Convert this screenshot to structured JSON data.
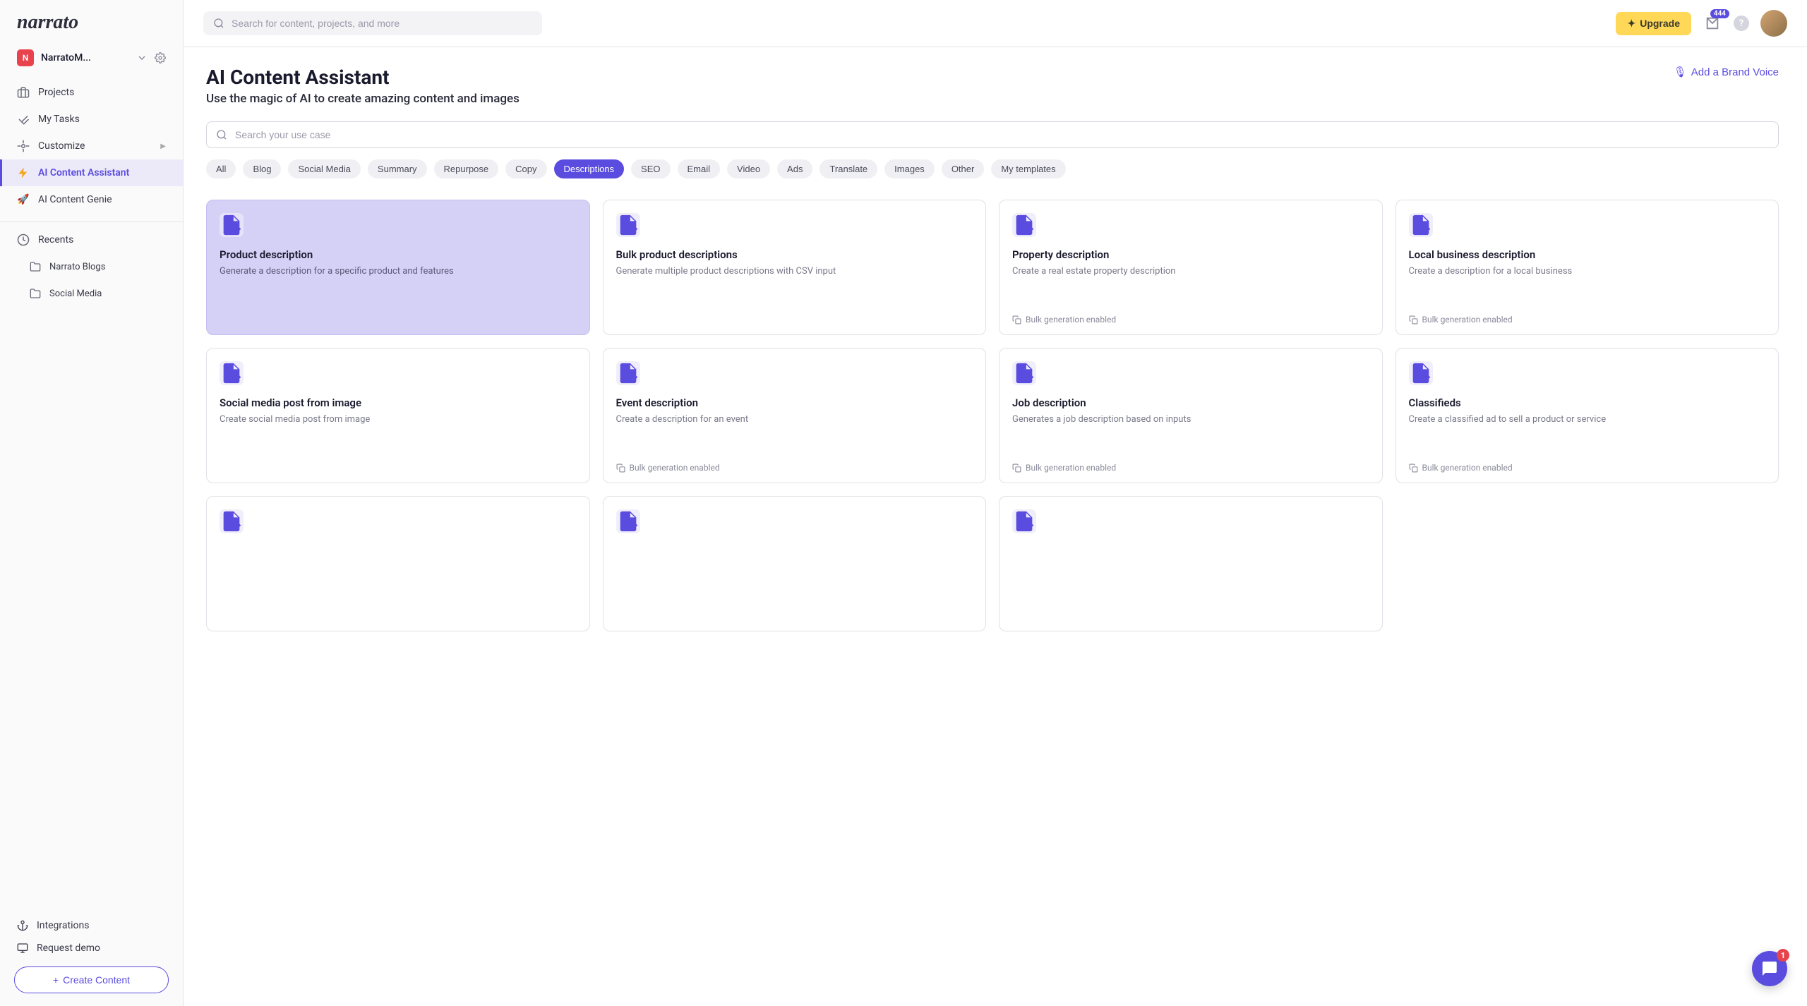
{
  "logo": "narrato",
  "workspace": {
    "badge": "N",
    "name": "NarratoM..."
  },
  "nav": {
    "projects": "Projects",
    "tasks": "My Tasks",
    "customize": "Customize",
    "assistant": "AI Content Assistant",
    "genie": "AI Content Genie",
    "recents": "Recents",
    "recent1": "Narrato Blogs",
    "recent2": "Social Media"
  },
  "footer": {
    "integrations": "Integrations",
    "demo": "Request demo",
    "create": "Create Content"
  },
  "topbar": {
    "search_placeholder": "Search for content, projects, and more",
    "upgrade": "Upgrade",
    "notif_count": "444",
    "chat_badge": "1"
  },
  "page": {
    "title": "AI Content Assistant",
    "subtitle": "Use the magic of AI to create amazing content and images",
    "brand_voice": "Add a Brand Voice",
    "usecase_placeholder": "Search your use case"
  },
  "chips": [
    "All",
    "Blog",
    "Social Media",
    "Summary",
    "Repurpose",
    "Copy",
    "Descriptions",
    "SEO",
    "Email",
    "Video",
    "Ads",
    "Translate",
    "Images",
    "Other",
    "My templates"
  ],
  "active_chip": 6,
  "bulk_label": "Bulk generation enabled",
  "cards": [
    {
      "title": "Product description",
      "desc": "Generate a description for a specific product and features",
      "bulk": false,
      "highlight": true
    },
    {
      "title": "Bulk product descriptions",
      "desc": "Generate multiple product descriptions with CSV input",
      "bulk": false
    },
    {
      "title": "Property description",
      "desc": "Create a real estate property description",
      "bulk": true
    },
    {
      "title": "Local business description",
      "desc": "Create a description for a local business",
      "bulk": true
    },
    {
      "title": "Social media post from image",
      "desc": "Create social media post from image",
      "bulk": false
    },
    {
      "title": "Event description",
      "desc": "Create a description for an event",
      "bulk": true
    },
    {
      "title": "Job description",
      "desc": "Generates a job description based on inputs",
      "bulk": true
    },
    {
      "title": "Classifieds",
      "desc": "Create a classified ad to sell a product or service",
      "bulk": true
    },
    {
      "title": "",
      "desc": "",
      "bulk": false,
      "stub": true
    },
    {
      "title": "",
      "desc": "",
      "bulk": false,
      "stub": true
    },
    {
      "title": "",
      "desc": "",
      "bulk": false,
      "stub": true
    }
  ]
}
